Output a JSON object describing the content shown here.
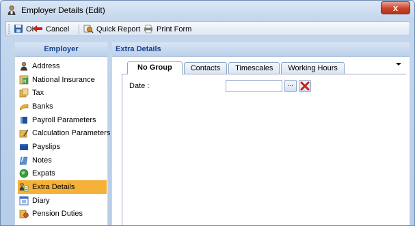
{
  "window": {
    "title": "Employer Details (Edit)",
    "close_label": "x"
  },
  "toolbar": {
    "ok_label": "OK",
    "cancel_label": "Cancel",
    "quick_report_label": "Quick Report",
    "print_form_label": "Print Form"
  },
  "left_panel": {
    "header": "Employer",
    "items": [
      {
        "label": "Address",
        "icon": "person-icon"
      },
      {
        "label": "National Insurance",
        "icon": "ni-icon"
      },
      {
        "label": "Tax",
        "icon": "tax-icon"
      },
      {
        "label": "Banks",
        "icon": "banks-icon"
      },
      {
        "label": "Payroll Parameters",
        "icon": "book-icon"
      },
      {
        "label": "Calculation Parameters",
        "icon": "pencil-icon"
      },
      {
        "label": "Payslips",
        "icon": "payslip-icon"
      },
      {
        "label": "Notes",
        "icon": "notes-icon"
      },
      {
        "label": "Expats",
        "icon": "globe-icon"
      },
      {
        "label": "Extra Details",
        "icon": "extra-details-icon"
      },
      {
        "label": "Diary",
        "icon": "diary-icon"
      },
      {
        "label": "Pension Duties",
        "icon": "pension-icon"
      }
    ],
    "selected_index": 9
  },
  "right_panel": {
    "header": "Extra Details",
    "tabs": [
      "No Group",
      "Contacts",
      "Timescales",
      "Working Hours"
    ],
    "active_tab": "No Group",
    "fields": {
      "date_label": "Date :",
      "date_value": "",
      "ellipsis_label": "..."
    }
  },
  "colors": {
    "selected_item": "#f5b13a",
    "header_text": "#15428b",
    "close_button": "#c7462b"
  }
}
